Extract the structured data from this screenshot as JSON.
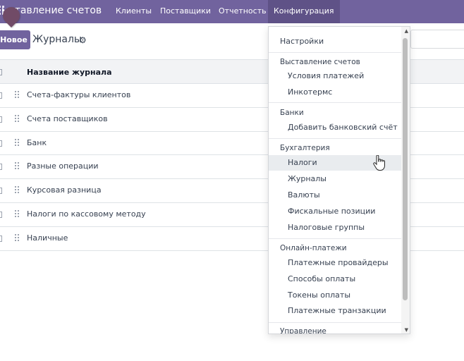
{
  "navbar": {
    "app_title": "ыставление счетов",
    "items": [
      {
        "label": "Клиенты"
      },
      {
        "label": "Поставщики"
      },
      {
        "label": "Отчетность"
      },
      {
        "label": "Конфигурация"
      }
    ],
    "color": "#71639e"
  },
  "control_panel": {
    "new_button": "Новое",
    "title": "Журналы",
    "gear_icon": "gear-icon"
  },
  "table": {
    "header": "Название журнала",
    "rows": [
      "Счета-фактуры клиентов",
      "Счета поставщиков",
      "Банк",
      "Разные операции",
      "Курсовая разница",
      "Налоги по кассовому методу",
      "Наличные"
    ]
  },
  "dropdown": {
    "settings": "Настройки",
    "sections": [
      {
        "header": "Выставление счетов",
        "items": [
          "Условия платежей",
          "Инкотермс"
        ]
      },
      {
        "header": "Банки",
        "items": [
          "Добавить банковский счёт"
        ]
      },
      {
        "header": "Бухгалтерия",
        "items": [
          "Налоги",
          "Журналы",
          "Валюты",
          "Фискальные позиции",
          "Налоговые группы"
        ]
      },
      {
        "header": "Онлайн-платежи",
        "items": [
          "Платежные провайдеры",
          "Способы оплаты",
          "Токены оплаты",
          "Платежные транзакции"
        ]
      },
      {
        "header": "Управление",
        "items": []
      }
    ],
    "hovered_item": "Налоги"
  }
}
